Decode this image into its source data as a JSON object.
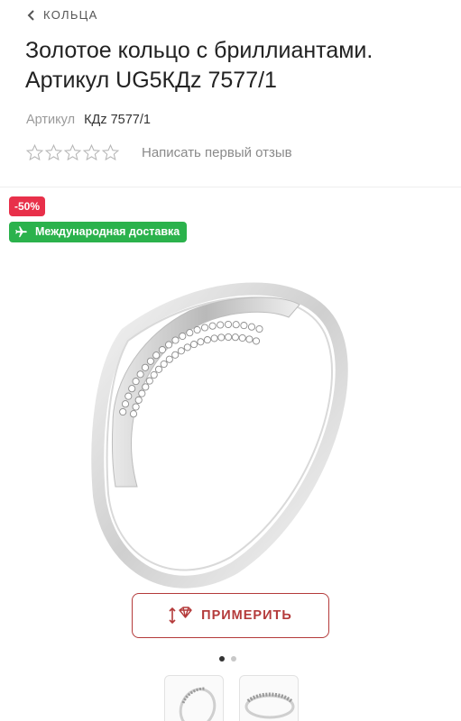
{
  "breadcrumb": {
    "label": "КОЛЬЦА"
  },
  "product": {
    "title": "Золотое кольцо с бриллиантами. Артикул UG5КДz 7577/1",
    "sku_label": "Артикул",
    "sku_value": "КДz 7577/1",
    "rating": {
      "stars_filled": 0,
      "stars_total": 5,
      "review_link": "Написать первый отзыв"
    }
  },
  "badges": {
    "sale": "-50%",
    "shipping": "Международная доставка",
    "sale_color": "#e8304a",
    "shipping_color": "#2bb24c"
  },
  "gallery": {
    "slides_total": 2,
    "active_slide": 1,
    "thumbnails": [
      "ring-front-view",
      "ring-top-view"
    ]
  },
  "try_on": {
    "label": "ПРИМЕРИТЬ",
    "icon": "diamond-arrows-icon",
    "accent": "#b43a3a"
  }
}
